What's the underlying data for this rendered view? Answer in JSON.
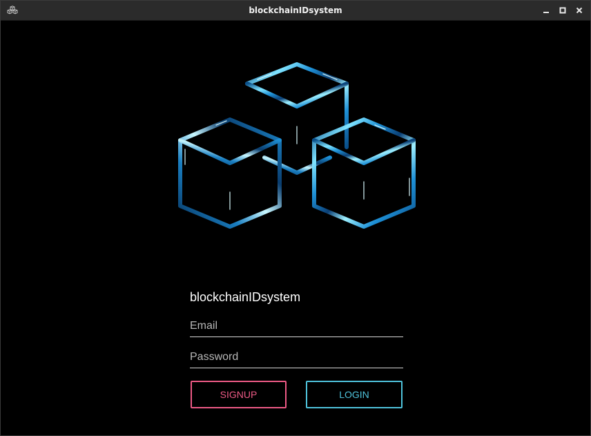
{
  "window": {
    "title": "blockchainIDsystem",
    "icons": {
      "app": "app-cubes-icon",
      "minimize": "minimize-icon",
      "maximize": "maximize-icon",
      "close": "close-icon"
    }
  },
  "logo": {
    "icon": "blockchain-cubes-logo",
    "accent_colors": [
      "#0a4f8a",
      "#1e90d6",
      "#7fe3ff",
      "#ffffff"
    ]
  },
  "form": {
    "app_name": "blockchainIDsystem",
    "email": {
      "value": "",
      "placeholder": "Email"
    },
    "password": {
      "value": "",
      "placeholder": "Password"
    },
    "signup_label": "SIGNUP",
    "login_label": "LOGIN"
  },
  "colors": {
    "background": "#000000",
    "titlebar": "#2b2b2b",
    "signup": "#ee5a86",
    "login": "#4fc3dc"
  }
}
